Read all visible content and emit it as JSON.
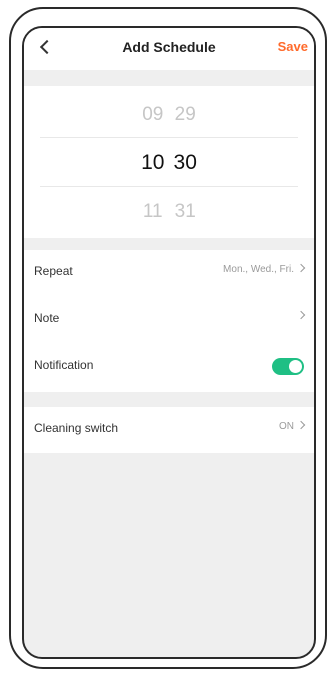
{
  "nav": {
    "title": "Add Schedule",
    "save_label": "Save"
  },
  "picker": {
    "rows": [
      {
        "hour": "09",
        "minute": "29"
      },
      {
        "hour": "10",
        "minute": "30"
      },
      {
        "hour": "11",
        "minute": "31"
      }
    ],
    "selected_index": 1
  },
  "settings": [
    {
      "label": "Repeat",
      "value": "Mon., Wed., Fri."
    },
    {
      "label": "Note",
      "value": ""
    },
    {
      "label": "Notification",
      "toggle_on": true
    }
  ],
  "cleaning": {
    "label": "Cleaning switch",
    "value": "ON"
  },
  "colors": {
    "accent": "#ff6a2b",
    "toggle_on": "#1fbf84",
    "background": "#efefef"
  }
}
